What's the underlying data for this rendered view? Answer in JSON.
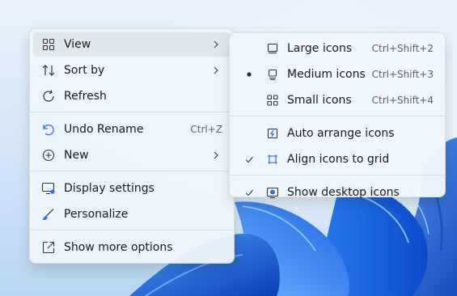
{
  "context_menu": {
    "items": [
      {
        "label": "View",
        "icon": "grid-icon",
        "has_submenu": true
      },
      {
        "label": "Sort by",
        "icon": "sort-arrows-icon",
        "has_submenu": true
      },
      {
        "label": "Refresh",
        "icon": "refresh-icon"
      },
      {
        "label": "Undo Rename",
        "icon": "undo-icon",
        "shortcut": "Ctrl+Z"
      },
      {
        "label": "New",
        "icon": "plus-circle-icon",
        "has_submenu": true
      },
      {
        "label": "Display settings",
        "icon": "monitor-settings-icon"
      },
      {
        "label": "Personalize",
        "icon": "brush-icon"
      },
      {
        "label": "Show more options",
        "icon": "open-external-icon"
      }
    ]
  },
  "view_submenu": {
    "items": [
      {
        "label": "Large icons",
        "shortcut": "Ctrl+Shift+2",
        "icon": "large-monitor-icon",
        "selected": false
      },
      {
        "label": "Medium icons",
        "shortcut": "Ctrl+Shift+3",
        "icon": "medium-monitor-icon",
        "selected": true,
        "marker": "bullet"
      },
      {
        "label": "Small icons",
        "shortcut": "Ctrl+Shift+4",
        "icon": "small-grid-icon",
        "selected": false
      },
      {
        "label": "Auto arrange icons",
        "icon": "auto-arrange-icon",
        "checked": false
      },
      {
        "label": "Align icons to grid",
        "icon": "align-grid-icon",
        "checked": true,
        "marker": "checkmark"
      },
      {
        "label": "Show desktop icons",
        "icon": "desktop-icons-icon",
        "checked": true,
        "marker": "checkmark"
      }
    ]
  },
  "colors": {
    "menu_background": "#eef5fc",
    "hover_background": "#e6ebf1",
    "text": "#1a1a1a",
    "shortcut_text": "#5f5f5f",
    "wallpaper_blue": "#1a5fd6"
  }
}
